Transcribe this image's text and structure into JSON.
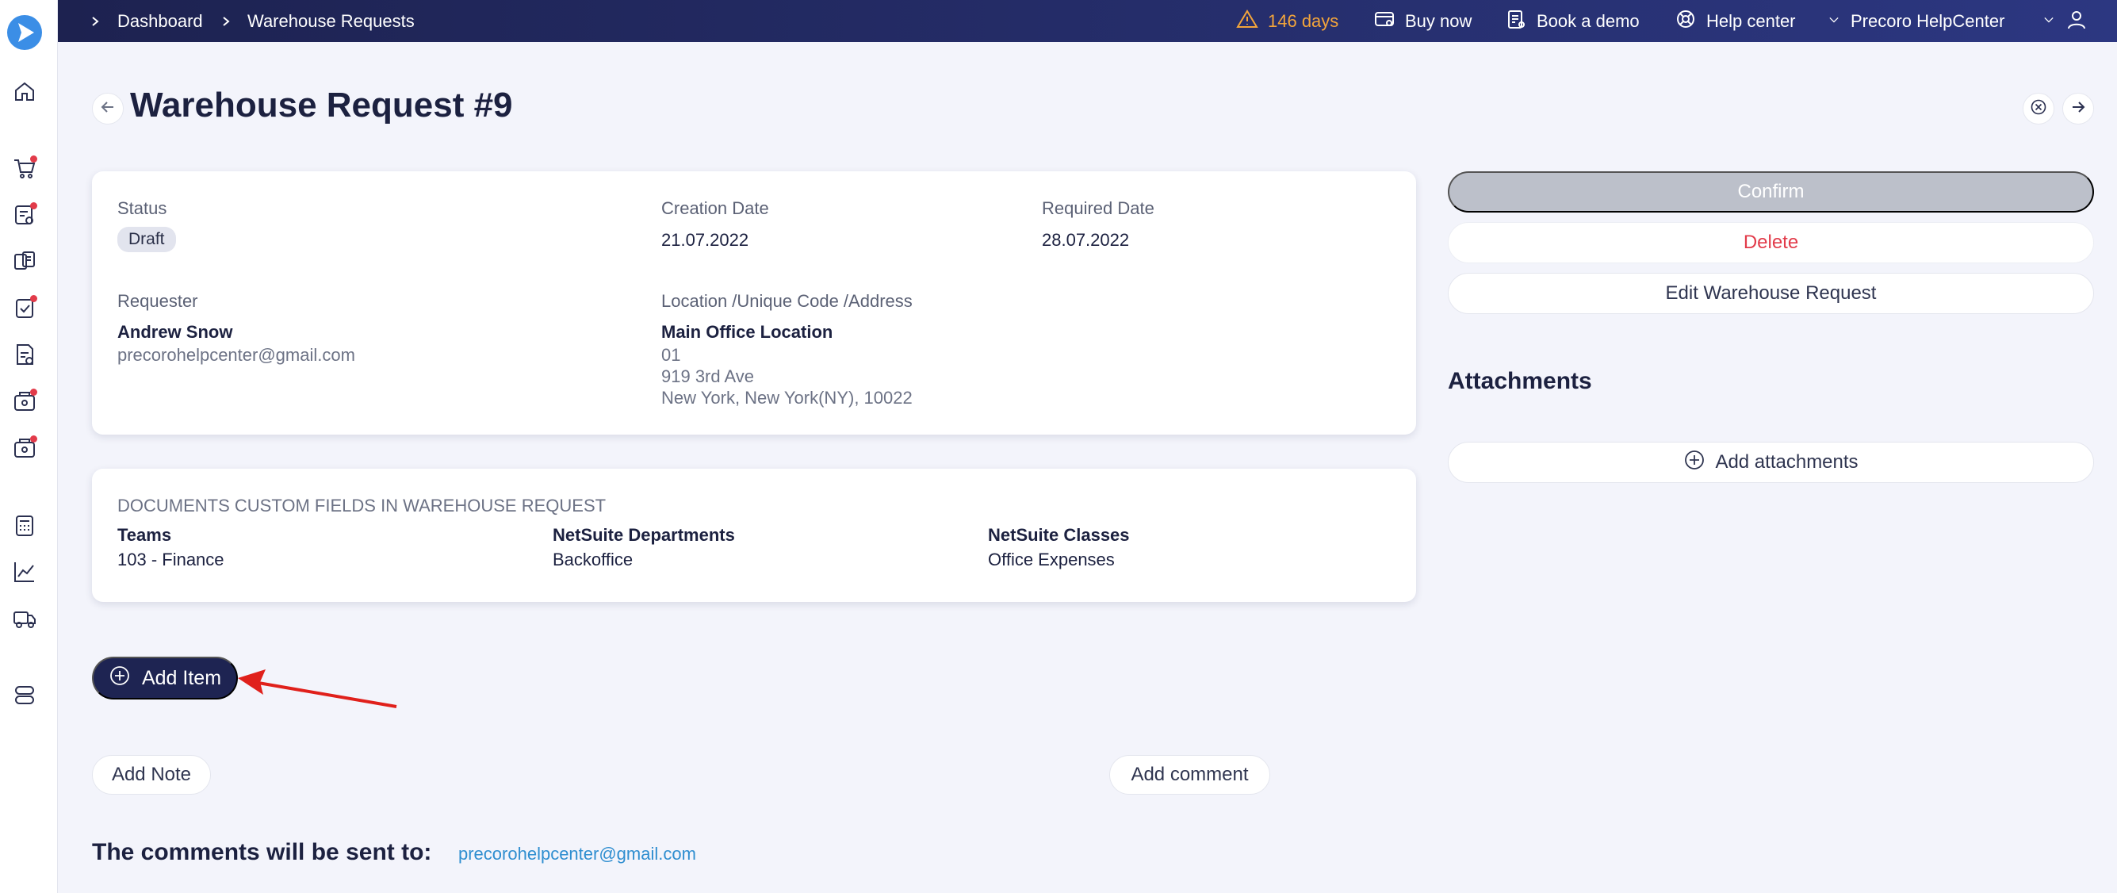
{
  "topbar": {
    "breadcrumbs": [
      "Dashboard",
      "Warehouse Requests"
    ],
    "trial_days": "146 days",
    "buy_now": "Buy now",
    "book_demo": "Book a demo",
    "help_center": "Help center",
    "company": "Precoro HelpCenter"
  },
  "page": {
    "title": "Warehouse Request #9"
  },
  "details": {
    "status_label": "Status",
    "status_value": "Draft",
    "creation_label": "Creation Date",
    "creation_value": "21.07.2022",
    "required_label": "Required Date",
    "required_value": "28.07.2022",
    "requester_label": "Requester",
    "requester_name": "Andrew Snow",
    "requester_email": "precorohelpcenter@gmail.com",
    "location_label": "Location /Unique Code /Address",
    "location_name": "Main Office Location",
    "location_code": "01",
    "location_street": "919 3rd Ave",
    "location_city": "New York, New York(NY), 10022"
  },
  "custom_fields": {
    "heading": "DOCUMENTS CUSTOM FIELDS IN WAREHOUSE REQUEST",
    "fields": [
      {
        "label": "Teams",
        "value": "103 - Finance"
      },
      {
        "label": "NetSuite Departments",
        "value": "Backoffice"
      },
      {
        "label": "NetSuite Classes",
        "value": "Office Expenses"
      }
    ]
  },
  "actions": {
    "confirm": "Confirm",
    "delete": "Delete",
    "edit": "Edit Warehouse Request"
  },
  "attachments": {
    "title": "Attachments",
    "add": "Add attachments"
  },
  "items": {
    "add_item": "Add Item"
  },
  "notes": {
    "add_note": "Add Note",
    "add_comment": "Add comment",
    "comments_title": "The comments will be sent to:",
    "comments_email": "precorohelpcenter@gmail.com"
  },
  "colors": {
    "topbar": "#1d2250",
    "primary": "#1e2452",
    "danger": "#e23b4a",
    "warning": "#f3a53b",
    "link": "#2f8ed0",
    "annotation_arrow": "#e0201b"
  },
  "icons": {
    "sidebar": [
      "home-icon",
      "cart-icon",
      "requisition-icon",
      "invoice-icon",
      "approval-icon",
      "receipt-icon",
      "budget-icon",
      "budget-alt-icon",
      "calculator-icon",
      "analytics-icon",
      "truck-icon",
      "settings-toggle-icon"
    ]
  }
}
